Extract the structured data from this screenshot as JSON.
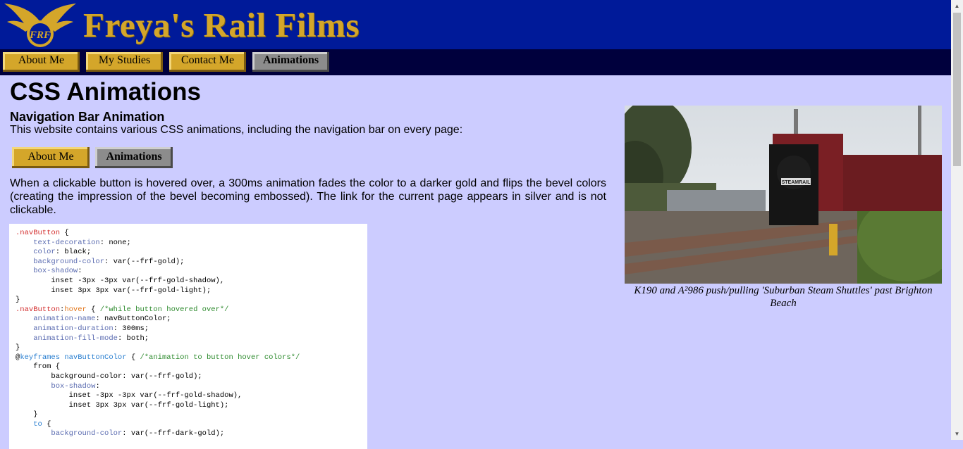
{
  "header": {
    "title": "Freya's Rail Films",
    "logo_text": "FRF"
  },
  "nav": {
    "items": [
      {
        "label": "About Me",
        "current": false
      },
      {
        "label": "My Studies",
        "current": false
      },
      {
        "label": "Contact Me",
        "current": false
      },
      {
        "label": "Animations",
        "current": true
      }
    ]
  },
  "main": {
    "heading": "CSS Animations",
    "subheading": "Navigation Bar Animation",
    "intro": "This website contains various CSS animations, including the navigation bar on every page:",
    "demo_buttons": [
      "About Me",
      "Animations"
    ],
    "description": "When a clickable button is hovered over, a 300ms animation fades the color to a darker gold and flips the bevel colors (creating the impression of the bevel becoming embossed). The link for the current page appears in silver and is not clickable."
  },
  "figure": {
    "caption": "K190 and A²986 push/pulling 'Suburban Steam Shuttles' past Brighton Beach",
    "locomotive_plate": "STEAMRAIL"
  },
  "colors": {
    "header_bg": "#001a99",
    "nav_bg": "#00003d",
    "gold": "#d4a62a",
    "silver": "#8c8c8c",
    "page_bg": "#ccccff"
  }
}
